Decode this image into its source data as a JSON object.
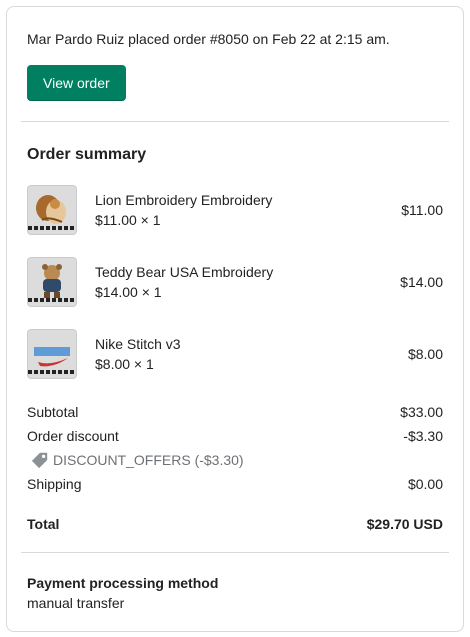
{
  "notice": "Mar Pardo Ruiz placed order #8050 on Feb 22 at 2:15 am.",
  "view_order_label": "View order",
  "summary": {
    "title": "Order summary",
    "items": [
      {
        "name": "Lion Embroidery Embroidery",
        "qty": "$11.00 × 1",
        "price": "$11.00",
        "icon": "lion-embroidery-thumbnail"
      },
      {
        "name": "Teddy Bear USA Embroidery",
        "qty": "$14.00 × 1",
        "price": "$14.00",
        "icon": "teddy-bear-thumbnail"
      },
      {
        "name": "Nike Stitch v3",
        "qty": "$8.00 × 1",
        "price": "$8.00",
        "icon": "nike-stitch-thumbnail"
      }
    ],
    "subtotal_label": "Subtotal",
    "subtotal_value": "$33.00",
    "discount_label": "Order discount",
    "discount_value": "-$3.30",
    "discount_code": "DISCOUNT_OFFERS (-$3.30)",
    "shipping_label": "Shipping",
    "shipping_value": "$0.00",
    "total_label": "Total",
    "total_value": "$29.70 USD"
  },
  "payment": {
    "title": "Payment processing method",
    "value": "manual transfer"
  },
  "colors": {
    "primary_button": "#008060",
    "muted_text": "#6d7175",
    "border": "#d7d9db"
  }
}
